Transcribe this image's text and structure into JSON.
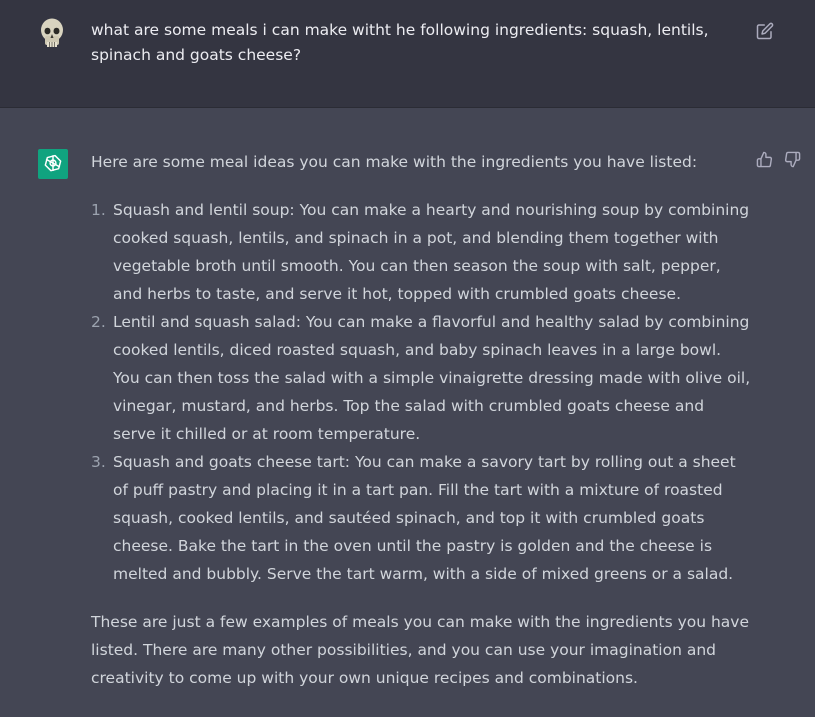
{
  "user_message": {
    "avatar_icon": "skull-icon",
    "text": "what are some meals i can make witht he following ingredients: squash, lentils, spinach and goats cheese?",
    "edit_icon": "edit-icon"
  },
  "assistant_message": {
    "avatar_icon": "openai-logo-icon",
    "avatar_color": "#10a37f",
    "intro": "Here are some meal ideas you can make with the ingredients you have listed:",
    "items": [
      {
        "number": "1.",
        "text": "Squash and lentil soup: You can make a hearty and nourishing soup by combining cooked squash, lentils, and spinach in a pot, and blending them together with vegetable broth until smooth. You can then season the soup with salt, pepper, and herbs to taste, and serve it hot, topped with crumbled goats cheese."
      },
      {
        "number": "2.",
        "text": "Lentil and squash salad: You can make a flavorful and healthy salad by combining cooked lentils, diced roasted squash, and baby spinach leaves in a large bowl. You can then toss the salad with a simple vinaigrette dressing made with olive oil, vinegar, mustard, and herbs. Top the salad with crumbled goats cheese and serve it chilled or at room temperature."
      },
      {
        "number": "3.",
        "text": "Squash and goats cheese tart: You can make a savory tart by rolling out a sheet of puff pastry and placing it in a tart pan. Fill the tart with a mixture of roasted squash, cooked lentils, and sautéed spinach, and top it with crumbled goats cheese. Bake the tart in the oven until the pastry is golden and the cheese is melted and bubbly. Serve the tart warm, with a side of mixed greens or a salad."
      }
    ],
    "outro": "These are just a few examples of meals you can make with the ingredients you have listed. There are many other possibilities, and you can use your imagination and creativity to come up with your own unique recipes and combinations.",
    "feedback_icons": [
      "thumbs-up-icon",
      "thumbs-down-icon"
    ]
  },
  "colors": {
    "user_bg": "#343541",
    "assistant_bg": "#444654",
    "text": "#d1d5db"
  }
}
